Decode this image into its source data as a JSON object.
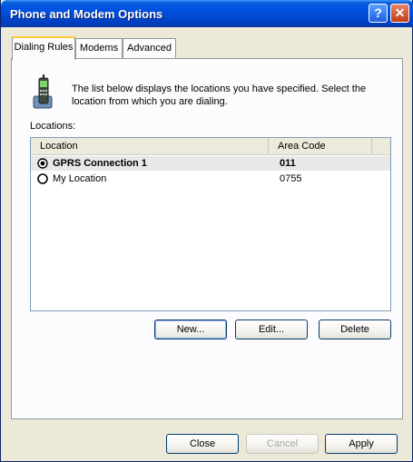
{
  "window": {
    "title": "Phone and Modem Options"
  },
  "titlebar": {
    "help_icon": "?",
    "close_icon": "✕"
  },
  "tabs": [
    {
      "label": "Dialing Rules",
      "active": true
    },
    {
      "label": "Modems",
      "active": false
    },
    {
      "label": "Advanced",
      "active": false
    }
  ],
  "dialing_rules": {
    "description": "The list below displays the locations you have specified. Select the location from which you are dialing.",
    "locations_label": "Locations:",
    "columns": [
      "Location",
      "Area Code"
    ],
    "rows": [
      {
        "location": "GPRS Connection 1",
        "area_code": "011",
        "selected": true
      },
      {
        "location": "My Location",
        "area_code": "0755",
        "selected": false
      }
    ],
    "buttons": {
      "new": "New...",
      "edit": "Edit...",
      "delete": "Delete"
    }
  },
  "footer": {
    "close": "Close",
    "cancel": "Cancel",
    "apply": "Apply"
  },
  "colors": {
    "title_bar": "#0054e3",
    "face": "#ece9d8",
    "panel": "#fcfcfe",
    "border": "#919b9c",
    "active_tab_accent": "#ffc83c"
  }
}
